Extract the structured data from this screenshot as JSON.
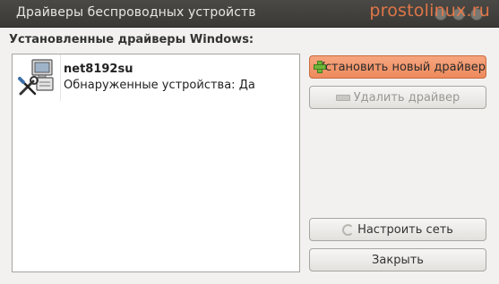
{
  "window": {
    "title": "Драйверы беспроводных устройств",
    "watermark": "prostolinux.ru"
  },
  "section": {
    "label": "Установленные драйверы Windows:"
  },
  "drivers": [
    {
      "name": "net8192su",
      "status": "Обнаруженные устройства: Да",
      "icon": "network-tools-icon"
    }
  ],
  "buttons": {
    "install": "Установить новый драйвер",
    "remove": "Удалить драйвер",
    "configure": "Настроить сеть",
    "close": "Закрыть"
  },
  "colors": {
    "accent": "#ee8a5c",
    "titlebar": "#3c3b37",
    "watermark": "#f07c4a"
  }
}
